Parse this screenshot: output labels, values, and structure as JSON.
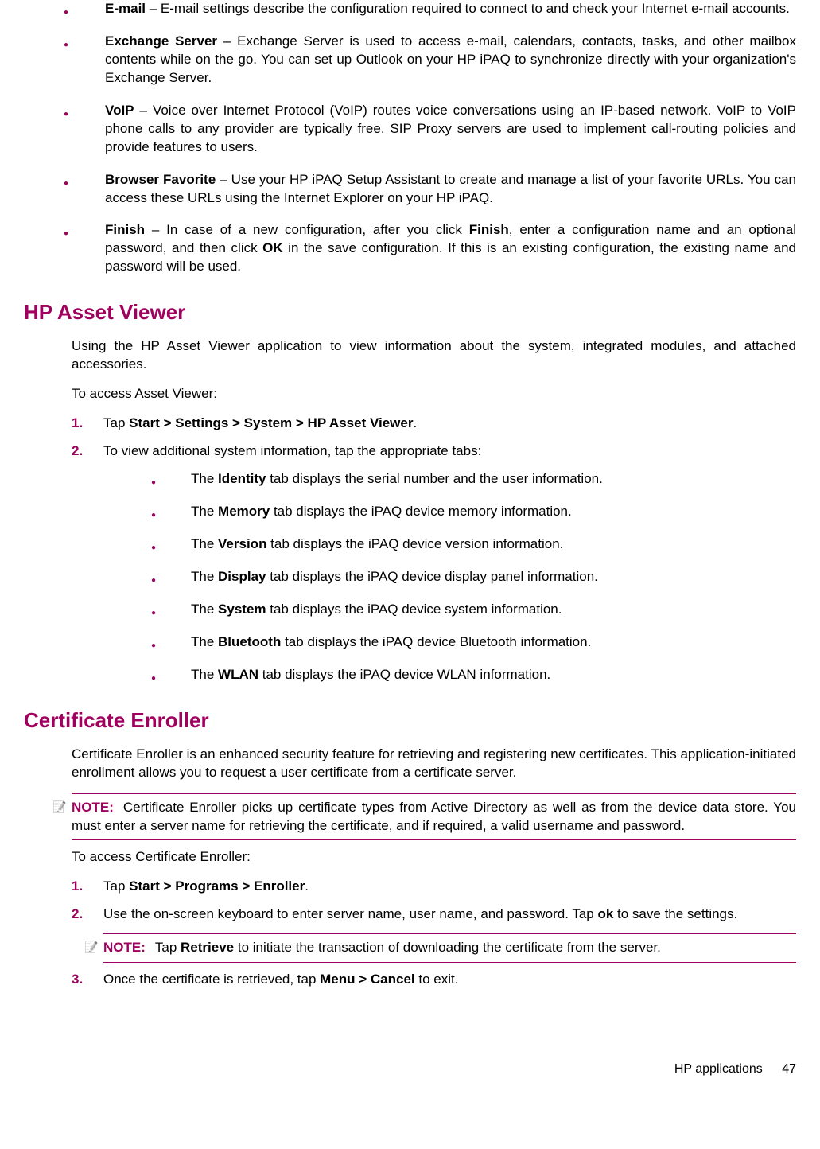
{
  "top_bullets": [
    {
      "title": "E-mail",
      "desc": " – E-mail settings describe the configuration required to connect to and check your Internet e-mail accounts."
    },
    {
      "title": "Exchange Server",
      "desc": " – Exchange Server is used to access e-mail, calendars, contacts, tasks, and other mailbox contents while on the go. You can set up Outlook on your HP iPAQ to synchronize directly with your organization's Exchange Server."
    },
    {
      "title": "VoIP",
      "desc": " – Voice over Internet Protocol (VoIP) routes voice conversations using an IP-based network. VoIP to VoIP phone calls to any provider are typically free. SIP Proxy servers are used to implement call-routing policies and provide features to users."
    },
    {
      "title": "Browser Favorite",
      "desc": " – Use your HP iPAQ Setup Assistant to create and manage a list of your favorite URLs. You can access these URLs using the Internet Explorer on your HP iPAQ."
    }
  ],
  "finish_bullet": {
    "title": "Finish",
    "pre": " – In case of a new configuration, after you click ",
    "b1": "Finish",
    "mid": ", enter a configuration name and an optional password, and then click ",
    "b2": "OK",
    "post": " in the save configuration. If this is an existing configuration, the existing name and password will be used."
  },
  "asset_viewer": {
    "heading": "HP Asset Viewer",
    "intro": "Using the HP Asset Viewer application to view information about the system, integrated modules, and attached accessories.",
    "to_access": "To access Asset Viewer:",
    "step1_pre": "Tap ",
    "step1_b": "Start > Settings > System > HP Asset Viewer",
    "step1_post": ".",
    "step2": "To view additional system information, tap the appropriate tabs:",
    "tabs": [
      {
        "pre": "The ",
        "b": "Identity",
        "post": " tab displays the serial number and the user information."
      },
      {
        "pre": "The ",
        "b": "Memory",
        "post": " tab displays the iPAQ device memory information."
      },
      {
        "pre": "The ",
        "b": "Version",
        "post": " tab displays the iPAQ device version information."
      },
      {
        "pre": "The ",
        "b": "Display",
        "post": " tab displays the iPAQ device display panel information."
      },
      {
        "pre": "The ",
        "b": "System",
        "post": " tab displays the iPAQ device system information."
      },
      {
        "pre": "The ",
        "b": "Bluetooth",
        "post": " tab displays the iPAQ device Bluetooth information."
      },
      {
        "pre": "The ",
        "b": "WLAN",
        "post": " tab displays the iPAQ device WLAN information."
      }
    ]
  },
  "cert_enroller": {
    "heading": "Certificate Enroller",
    "intro": "Certificate Enroller is an enhanced security feature for retrieving and registering new certificates. This application-initiated enrollment allows you to request a user certificate from a certificate server.",
    "note1_label": "NOTE:",
    "note1_text": "Certificate Enroller picks up certificate types from Active Directory as well as from the device data store. You must enter a server name for retrieving the certificate, and if required, a valid username and password.",
    "to_access": "To access Certificate Enroller:",
    "step1_pre": "Tap ",
    "step1_b": "Start > Programs > Enroller",
    "step1_post": ".",
    "step2_pre": "Use the on-screen keyboard to enter server name, user name, and password. Tap ",
    "step2_b": "ok",
    "step2_post": " to save the settings.",
    "note2_label": "NOTE:",
    "note2_pre": "Tap ",
    "note2_b": "Retrieve",
    "note2_post": " to initiate the transaction of downloading the certificate from the server.",
    "step3_pre": "Once the certificate is retrieved, tap ",
    "step3_b": "Menu > Cancel",
    "step3_post": " to exit."
  },
  "footer": {
    "section": "HP applications",
    "page": "47"
  },
  "nums": {
    "n1": "1.",
    "n2": "2.",
    "n3": "3."
  }
}
